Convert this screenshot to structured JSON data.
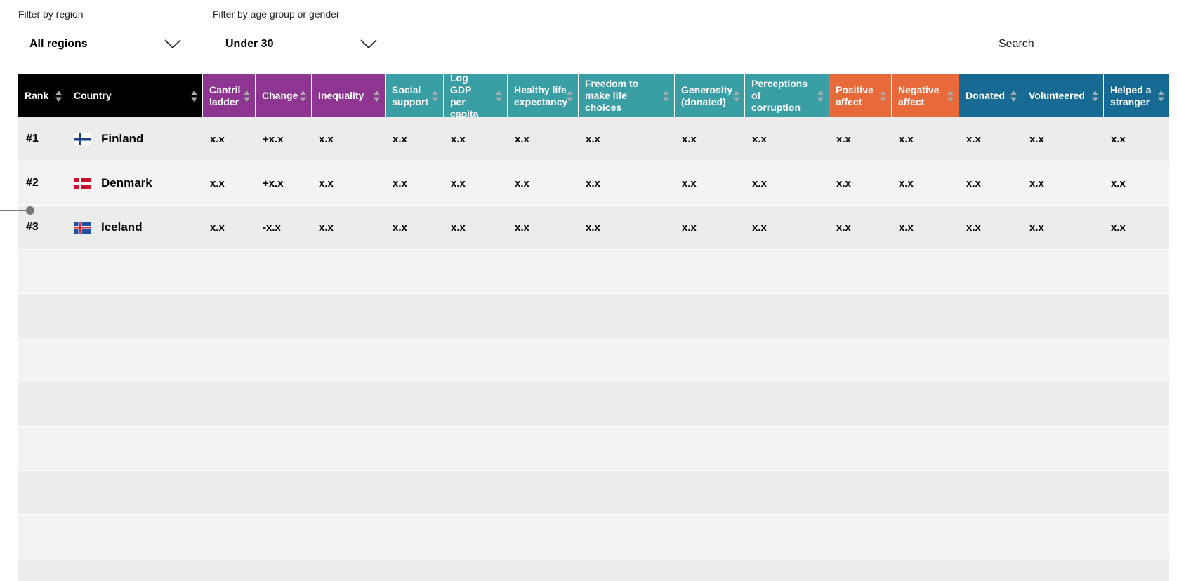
{
  "filters": {
    "region": {
      "label": "Filter by region",
      "value": "All regions"
    },
    "demographic": {
      "label": "Filter by age group or gender",
      "value": "Under 30"
    },
    "search": {
      "placeholder": "Search"
    }
  },
  "colors": {
    "black": "#000000",
    "purple": "#8e3591",
    "teal": "#3a9ea5",
    "orange": "#e8693a",
    "blue": "#166a93"
  },
  "columns": [
    {
      "label": "Rank",
      "color": "black"
    },
    {
      "label": "Country",
      "color": "black"
    },
    {
      "label": "Cantril\nladder",
      "color": "purple"
    },
    {
      "label": "Change",
      "color": "purple"
    },
    {
      "label": "Inequality",
      "color": "purple"
    },
    {
      "label": "Social\nsupport",
      "color": "teal"
    },
    {
      "label": "Log GDP\nper capita",
      "color": "teal"
    },
    {
      "label": "Healthy life\nexpectancy",
      "color": "teal"
    },
    {
      "label": "Freedom to\nmake life choices",
      "color": "teal"
    },
    {
      "label": "Generosity\n(donated)",
      "color": "teal"
    },
    {
      "label": "Perceptions\nof corruption",
      "color": "teal"
    },
    {
      "label": "Positive\naffect",
      "color": "orange"
    },
    {
      "label": "Negative\naffect",
      "color": "orange"
    },
    {
      "label": "Donated",
      "color": "blue"
    },
    {
      "label": "Volunteered",
      "color": "blue"
    },
    {
      "label": "Helped a\nstranger",
      "color": "blue"
    }
  ],
  "rows": [
    {
      "rank": "#1",
      "country": "Finland",
      "flag": "finland-flag-icon",
      "values": [
        "x.x",
        "+x.x",
        "x.x",
        "x.x",
        "x.x",
        "x.x",
        "x.x",
        "x.x",
        "x.x",
        "x.x",
        "x.x",
        "x.x",
        "x.x",
        "x.x"
      ]
    },
    {
      "rank": "#2",
      "country": "Denmark",
      "flag": "denmark-flag-icon",
      "values": [
        "x.x",
        "+x.x",
        "x.x",
        "x.x",
        "x.x",
        "x.x",
        "x.x",
        "x.x",
        "x.x",
        "x.x",
        "x.x",
        "x.x",
        "x.x",
        "x.x"
      ]
    },
    {
      "rank": "#3",
      "country": "Iceland",
      "flag": "iceland-flag-icon",
      "values": [
        "x.x",
        "-x.x",
        "x.x",
        "x.x",
        "x.x",
        "x.x",
        "x.x",
        "x.x",
        "x.x",
        "x.x",
        "x.x",
        "x.x",
        "x.x",
        "x.x"
      ]
    }
  ],
  "empty_rows": 8
}
